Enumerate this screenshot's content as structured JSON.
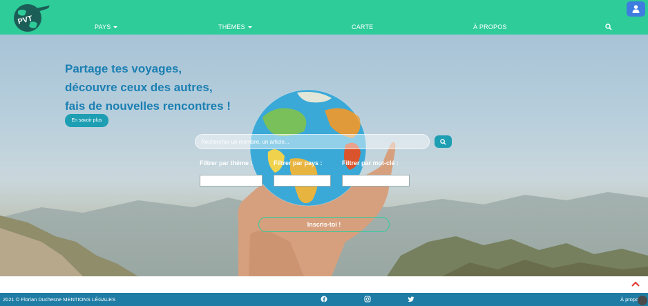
{
  "logo": {
    "text": "PVT"
  },
  "nav": {
    "items": [
      {
        "label": "PAYS",
        "has_dropdown": true
      },
      {
        "label": "THÈMES",
        "has_dropdown": true
      },
      {
        "label": "CARTE",
        "has_dropdown": false
      },
      {
        "label": "À PROPOS",
        "has_dropdown": false
      }
    ],
    "search_icon": "search-icon",
    "user_icon": "user-icon"
  },
  "hero": {
    "headline": [
      "Partage tes voyages,",
      "découvre ceux des autres,",
      "fais de nouvelles rencontres !"
    ],
    "learn_more": "En savoir plus",
    "search": {
      "placeholder": "Rechercher un membre, un article...",
      "value": ""
    },
    "filters": [
      {
        "label": "Filtrer par thème :"
      },
      {
        "label": "Filtrer par pays :"
      },
      {
        "label": "Filtrer par mot-clé :"
      }
    ],
    "signup": "Inscris-toi !"
  },
  "footer": {
    "copyright": "2021 © Florian Duchesne MENTIONS LÉGALES",
    "social": [
      "facebook-icon",
      "instagram-icon",
      "twitter-icon"
    ],
    "about": "À propos"
  },
  "colors": {
    "nav_bg": "#2ecc98",
    "headline": "#1b7fb2",
    "button_teal": "#1e9eb3",
    "user_button": "#3e7ce0",
    "footer_bg": "#1f7ca4",
    "scroll_arrow": "#e0322b"
  }
}
